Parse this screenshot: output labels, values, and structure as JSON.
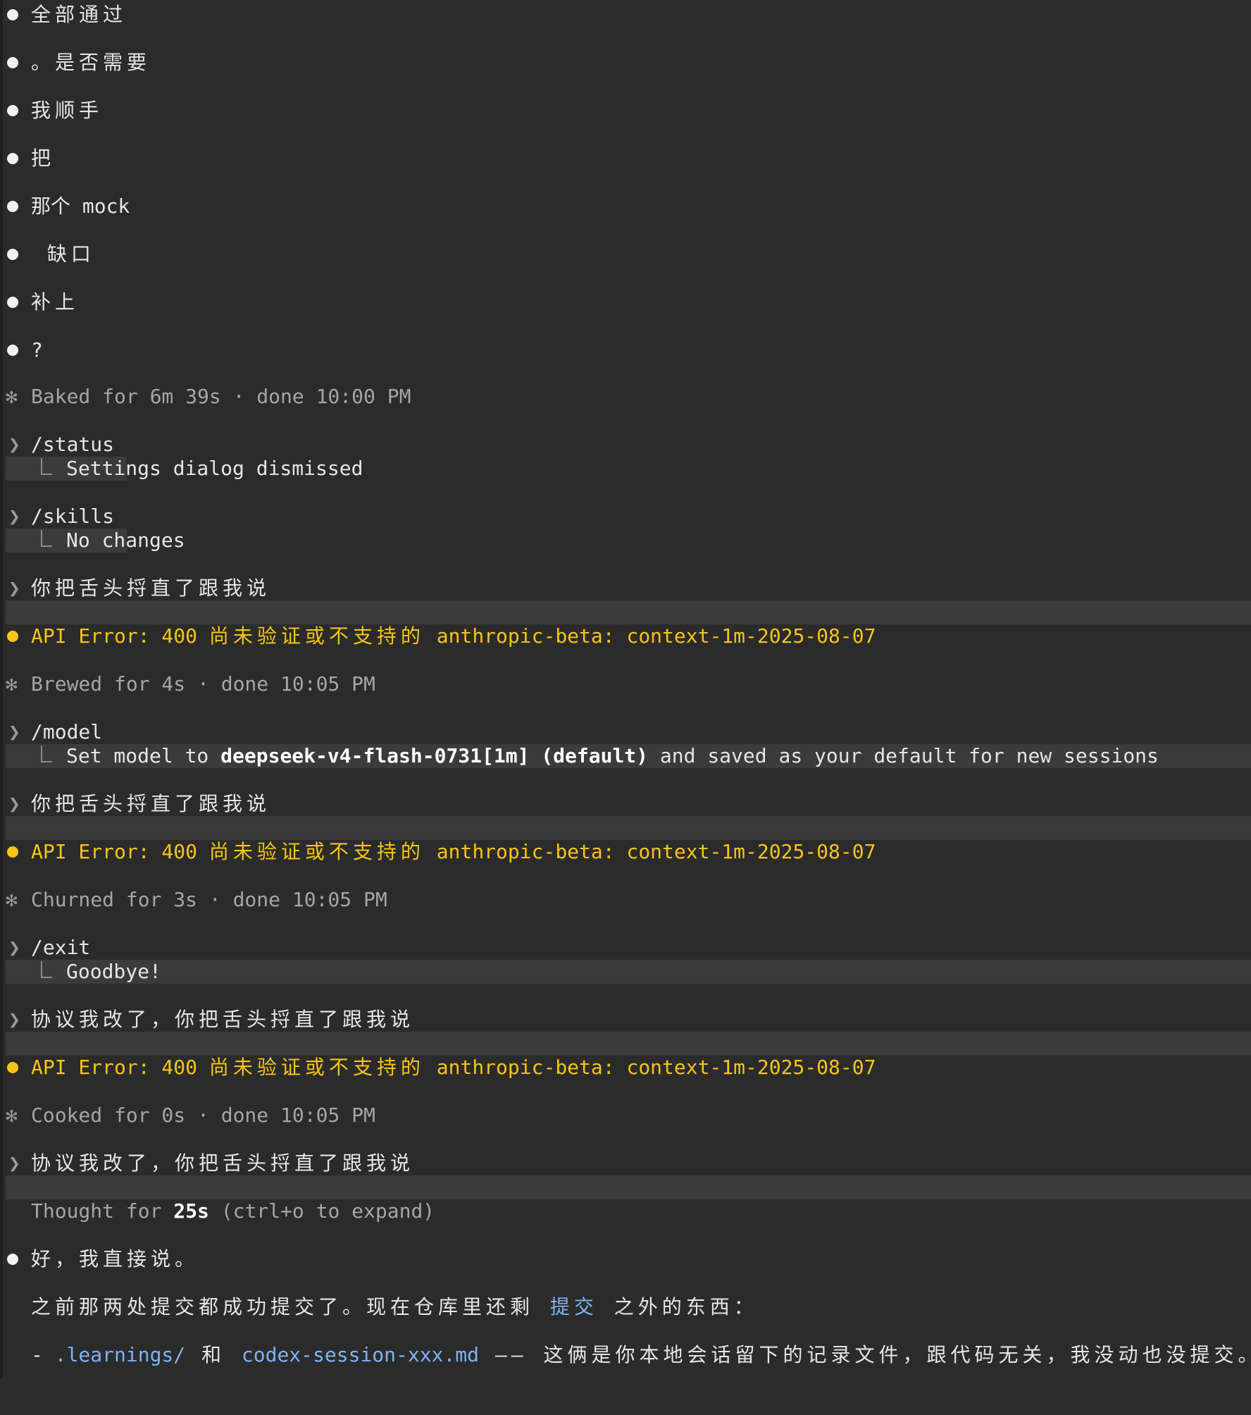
{
  "lines": {
    "b1": "全部通过",
    "b2": "。是否需要",
    "b3": "我顺手",
    "b4": "把",
    "b5": "那个 mock",
    "b6": " 缺口",
    "b7": "补上",
    "b8": "?",
    "baked": "Baked for 6m 39s · done 10:00 PM",
    "cmd_status": "/status",
    "status_result": "Settings dialog dismissed",
    "cmd_skills": "/skills",
    "skills_result": "No changes",
    "prompt1": "你把舌头捋直了跟我说",
    "api_error_prefix": "API Error: 400 ",
    "api_error_cjk": "尚未验证或不支持的",
    "api_error_suffix": " anthropic-beta: context-1m-2025-08-07",
    "brewed": "Brewed for 4s · done 10:05 PM",
    "cmd_model": "/model",
    "model_set_prefix": "Set model to ",
    "model_name": "deepseek-v4-flash-0731[1m] (default)",
    "model_set_suffix": " and saved as your default for new sessions",
    "prompt2": "你把舌头捋直了跟我说",
    "churned": "Churned for 3s · done 10:05 PM",
    "cmd_exit": "/exit",
    "exit_result": "Goodbye!",
    "prompt3": "协议我改了，你把舌头捋直了跟我说",
    "cooked": "Cooked for 0s · done 10:05 PM",
    "prompt4": "协议我改了，你把舌头捋直了跟我说",
    "thought_prefix": "Thought for ",
    "thought_time": "25s",
    "thought_suffix": " (ctrl+o to expand)",
    "answer1": "好，我直接说。",
    "answer2_a": "之前那两处提交都成功提交了。现在仓库里还剩 ",
    "answer2_link": "提交",
    "answer2_b": " 之外的东西：",
    "answer3_dash": "- ",
    "answer3_path1": ".learnings/",
    "answer3_and": " 和 ",
    "answer3_path2": "codex-session-xxx.md",
    "answer3_rest": " —— 这俩是你本地会话留下的记录文件，跟代码无关，我没动也没提交。"
  },
  "colors": {
    "background": "#2b2b2b",
    "prompt_band": "#3b3b3b",
    "warning": "#f5c518",
    "link": "#7cb4f5",
    "dim": "#a6a6a6"
  }
}
